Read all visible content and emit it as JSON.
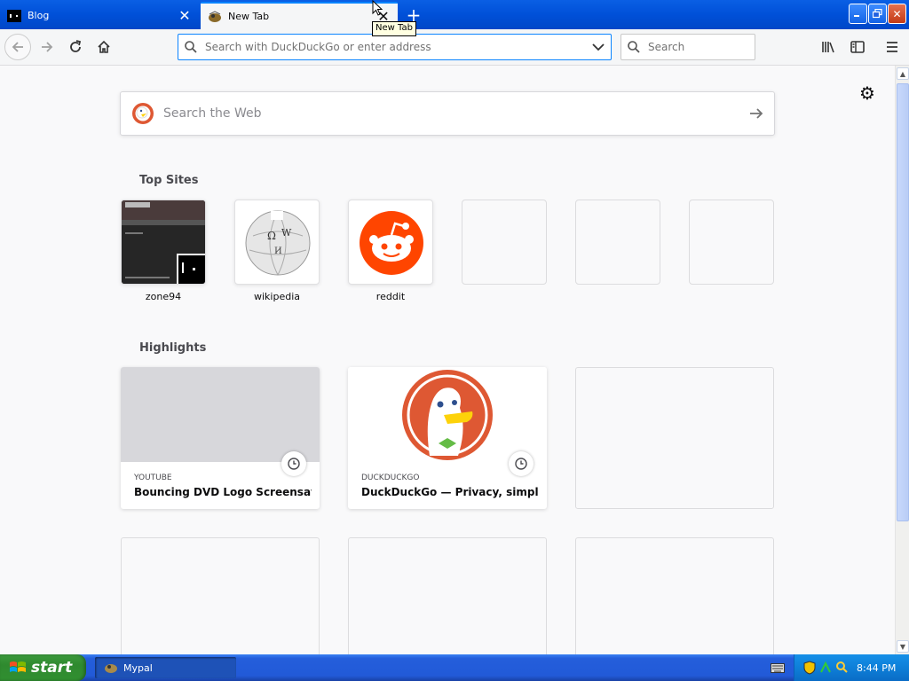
{
  "tabs": [
    {
      "label": "Blog",
      "active": false
    },
    {
      "label": "New Tab",
      "active": true
    }
  ],
  "tooltip": "New Tab",
  "toolbar": {
    "url_placeholder": "Search with DuckDuckGo or enter address",
    "search_placeholder": "Search"
  },
  "page": {
    "web_search_placeholder": "Search the Web",
    "top_sites_title": "Top Sites",
    "top_sites": [
      {
        "label": "zone94"
      },
      {
        "label": "wikipedia"
      },
      {
        "label": "reddit"
      },
      {
        "label": ""
      },
      {
        "label": ""
      },
      {
        "label": ""
      }
    ],
    "highlights_title": "Highlights",
    "highlights": [
      {
        "source": "YOUTUBE",
        "title": "Bouncing DVD Logo Screensave…"
      },
      {
        "source": "DUCKDUCKGO",
        "title": "DuckDuckGo — Privacy, simplifi…"
      }
    ]
  },
  "taskbar": {
    "start_label": "start",
    "task_label": "Mypal",
    "clock": "8:44 PM"
  },
  "colors": {
    "titlebar_blue": "#0050d8",
    "accent_blue": "#0a84ff",
    "reddit_orange": "#ff4500",
    "ddg_orange": "#de5833",
    "start_green": "#318f31"
  }
}
